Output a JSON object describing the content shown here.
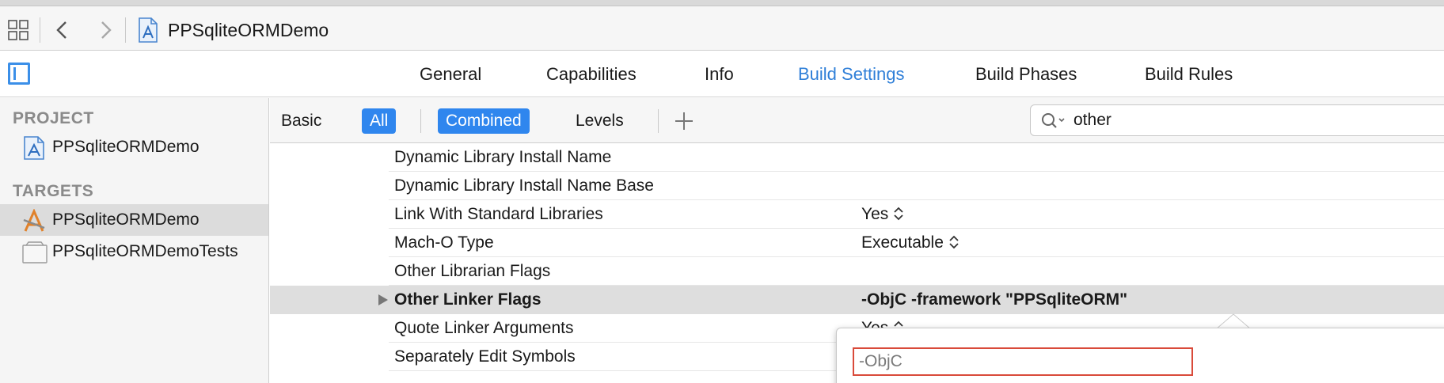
{
  "navbar": {
    "project_title": "PPSqliteORMDemo"
  },
  "tabs": [
    {
      "label": "General"
    },
    {
      "label": "Capabilities"
    },
    {
      "label": "Info"
    },
    {
      "label": "Build Settings",
      "active": true
    },
    {
      "label": "Build Phases"
    },
    {
      "label": "Build Rules"
    }
  ],
  "sidebar": {
    "project_header": "PROJECT",
    "project_item": "PPSqliteORMDemo",
    "targets_header": "TARGETS",
    "targets": [
      {
        "label": "PPSqliteORMDemo",
        "selected": true
      },
      {
        "label": "PPSqliteORMDemoTests",
        "selected": false
      }
    ]
  },
  "filter": {
    "basic": "Basic",
    "all": "All",
    "combined": "Combined",
    "levels": "Levels",
    "search_value": "other"
  },
  "settings": [
    {
      "name": "Dynamic Library Install Name",
      "value": ""
    },
    {
      "name": "Dynamic Library Install Name Base",
      "value": ""
    },
    {
      "name": "Link With Standard Libraries",
      "value": "Yes"
    },
    {
      "name": "Mach-O Type",
      "value": "Executable"
    },
    {
      "name": "Other Librarian Flags",
      "value": ""
    },
    {
      "name": "Other Linker Flags",
      "value": "-ObjC -framework \"PPSqliteORM\""
    },
    {
      "name": "Quote Linker Arguments",
      "value": "Yes"
    },
    {
      "name": "Separately Edit Symbols",
      "value": ""
    }
  ],
  "popover": {
    "first_value": "-ObjC"
  },
  "colors": {
    "accent": "#2f86ee",
    "active_tab": "#2f7fd8",
    "edit_border": "#d94a3a"
  }
}
